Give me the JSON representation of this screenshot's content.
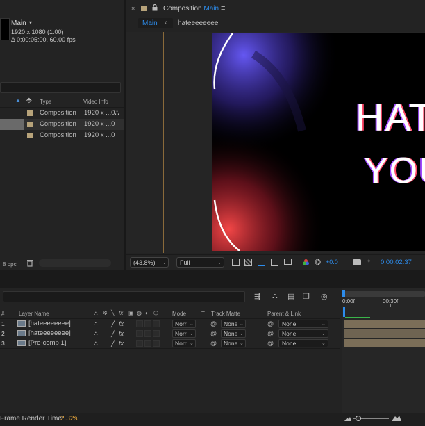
{
  "project": {
    "selected_name": "Main",
    "selected_specs": "1920 x 1080 (1.00)",
    "selected_duration": "Δ 0:00:05:00, 60.00 fps",
    "search_placeholder": "",
    "columns": {
      "type": "Type",
      "video_info": "Video Info"
    },
    "items": [
      {
        "type": "Composition",
        "info": "1920 x ...0",
        "selected": false,
        "color": "#b7a37a"
      },
      {
        "type": "Composition",
        "info": "1920 x ...0",
        "selected": true,
        "color": "#b7a37a"
      },
      {
        "type": "Composition",
        "info": "1920 x ...0",
        "selected": false,
        "color": "#b7a37a"
      }
    ],
    "bpc": "8 bpc"
  },
  "viewer": {
    "panel_label": "Composition",
    "panel_comp": "Main",
    "menu_icon": "≡",
    "tabs": [
      {
        "label": "Main",
        "active": true
      },
      {
        "label": "hateeeeeeee",
        "active": false
      }
    ],
    "preview_text_line1": "HAT",
    "preview_text_line2": "YOU",
    "zoom": "(43.8%)",
    "resolution": "Full",
    "exposure": "+0.0",
    "timecode": "0:00:02:37"
  },
  "timeline": {
    "search_placeholder": "",
    "columns": {
      "num": "#",
      "layer_name": "Layer Name",
      "mode": "Mode",
      "t": "T",
      "track_matte": "Track Matte",
      "parent": "Parent & Link"
    },
    "ruler": {
      "start": "0:00f",
      "mark": "00:30f"
    },
    "layers": [
      {
        "num": "1",
        "name": "[hateeeeeeee]",
        "mode": "Norr",
        "matte": "None",
        "parent": "None"
      },
      {
        "num": "2",
        "name": "[hateeeeeeee]",
        "mode": "Norr",
        "matte": "None",
        "parent": "None"
      },
      {
        "num": "3",
        "name": "[Pre-comp 1]",
        "mode": "Norr",
        "matte": "None",
        "parent": "None"
      }
    ]
  },
  "status": {
    "label": "Frame Render Time:",
    "value": "2.32s"
  },
  "colors": {
    "accent_blue": "#2d8ceb",
    "label_tan": "#b7a37a",
    "render_time": "#e8a63a",
    "work_area_green": "#3ab44a"
  }
}
